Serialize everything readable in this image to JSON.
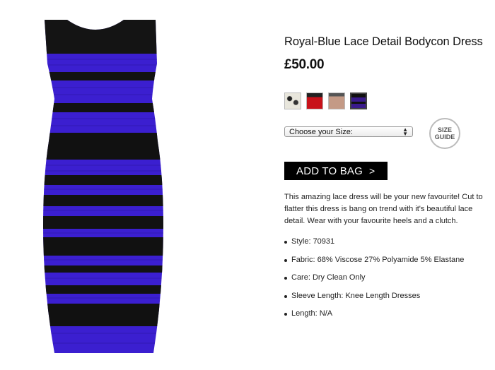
{
  "product": {
    "title": "Royal-Blue Lace Detail Bodycon Dress",
    "price": "£50.00"
  },
  "swatches": [
    {
      "name": "white-black-floral",
      "color": "#e8e6dc",
      "selected": false
    },
    {
      "name": "red",
      "color": "#c8121a",
      "selected": false
    },
    {
      "name": "nude",
      "color": "#c49a86",
      "selected": false
    },
    {
      "name": "royal-blue",
      "color": "#3a1a8c",
      "selected": true
    }
  ],
  "size": {
    "select_label": "Choose your Size:",
    "guide_line1": "SIZE",
    "guide_line2": "GUIDE"
  },
  "cart": {
    "add_label": "ADD TO BAG",
    "chevron": ">"
  },
  "description": "This amazing lace dress will be your new favourite! Cut to flatter this dress is bang on trend with it's beautiful lace detail. Wear with your favourite heels and a clutch.",
  "specs": [
    "Style: 70931",
    "Fabric: 68% Viscose 27% Polyamide 5% Elastane",
    "Care: Dry Clean Only",
    "Sleeve Length: Knee Length Dresses",
    "Length: N/A"
  ],
  "colors": {
    "dress_blue": "#3b1fd0",
    "dress_black": "#111111",
    "button_bg": "#000000"
  }
}
